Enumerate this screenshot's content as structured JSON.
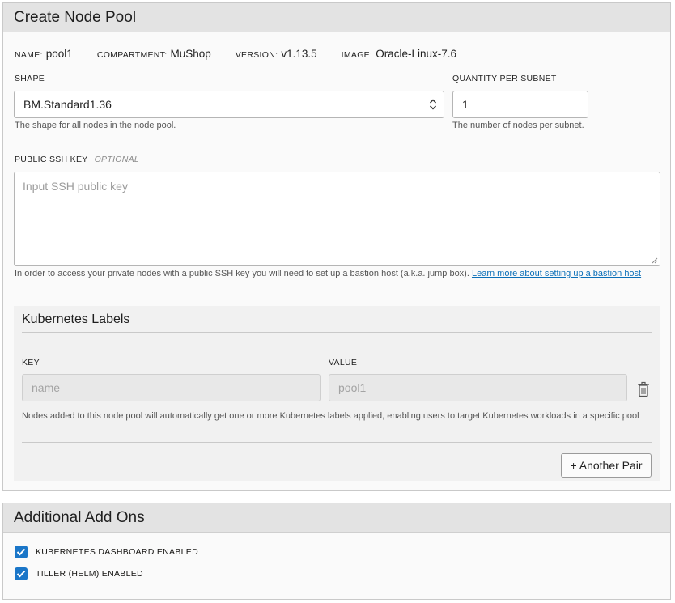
{
  "create_node_pool": {
    "title": "Create Node Pool",
    "meta": [
      {
        "key": "NAME:",
        "value": "pool1"
      },
      {
        "key": "COMPARTMENT:",
        "value": "MuShop"
      },
      {
        "key": "VERSION:",
        "value": "v1.13.5"
      },
      {
        "key": "IMAGE:",
        "value": "Oracle-Linux-7.6"
      }
    ],
    "shape": {
      "label": "SHAPE",
      "value": "BM.Standard1.36",
      "help": "The shape for all nodes in the node pool."
    },
    "quantity": {
      "label": "QUANTITY PER SUBNET",
      "value": "1",
      "help": "The number of nodes per subnet."
    },
    "ssh": {
      "label": "PUBLIC SSH KEY",
      "optional": "OPTIONAL",
      "placeholder": "Input SSH public key",
      "help": "In order to access your private nodes with a public SSH key you will need to set up a bastion host (a.k.a. jump box).",
      "link": "Learn more about setting up a bastion host"
    },
    "labels": {
      "title": "Kubernetes Labels",
      "key_label": "KEY",
      "value_label": "VALUE",
      "key_placeholder": "name",
      "value_placeholder": "pool1",
      "help": "Nodes added to this node pool will automatically get one or more Kubernetes labels applied, enabling users to target Kubernetes workloads in a specific pool",
      "add_button": "+ Another Pair"
    }
  },
  "addons": {
    "title": "Additional Add Ons",
    "options": [
      {
        "label": "KUBERNETES DASHBOARD ENABLED",
        "checked": true
      },
      {
        "label": "TILLER (HELM) ENABLED",
        "checked": true
      }
    ]
  },
  "colors": {
    "accent": "#1a76c8",
    "link": "#0a6fb8",
    "header_bg": "#e3e3e3"
  },
  "icons": [
    "select-arrows-icon",
    "trash-icon",
    "checkmark-icon",
    "resize-grip-icon"
  ]
}
